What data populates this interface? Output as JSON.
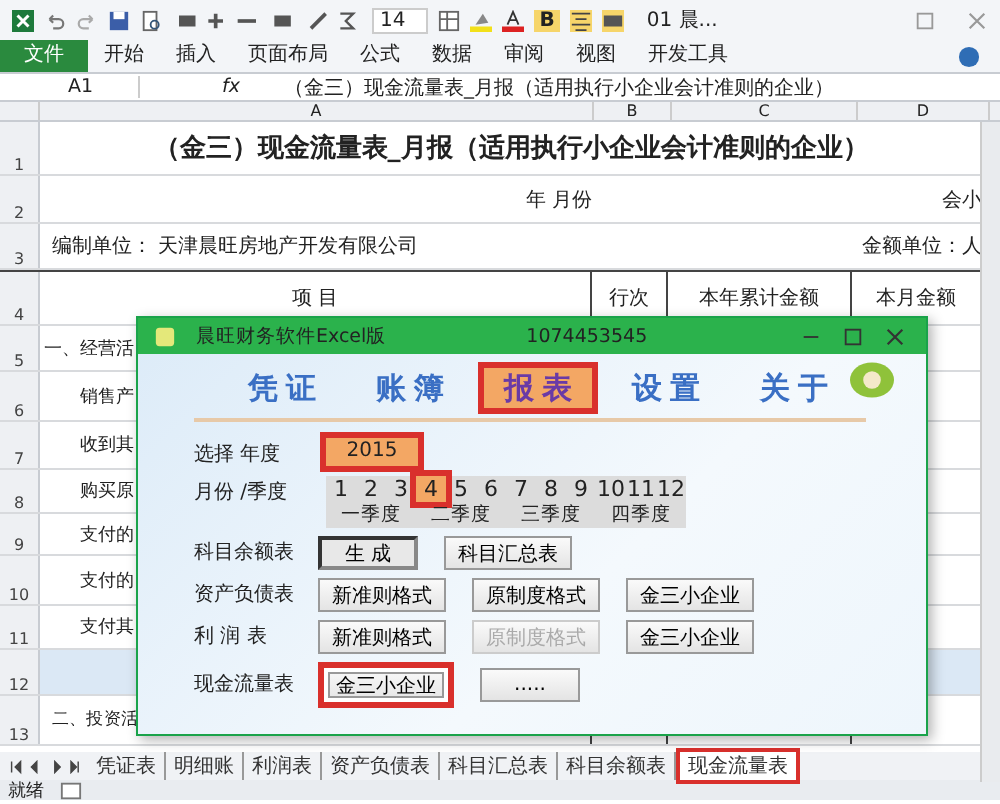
{
  "window": {
    "title": "01 晨..."
  },
  "toolbar": {
    "font_size": "14",
    "bold": "B"
  },
  "ribbon_tabs": [
    {
      "label": "文件",
      "selected": true
    },
    {
      "label": "开始",
      "selected": false
    },
    {
      "label": "插入",
      "selected": false
    },
    {
      "label": "页面布局",
      "selected": false
    },
    {
      "label": "公式",
      "selected": false
    },
    {
      "label": "数据",
      "selected": false
    },
    {
      "label": "审阅",
      "selected": false
    },
    {
      "label": "视图",
      "selected": false
    },
    {
      "label": "开发工具",
      "selected": false
    }
  ],
  "formula_bar": {
    "cell": "A1",
    "fx": "fx",
    "value": "（金三）现金流量表_月报（适用执行小企业会计准则的企业）"
  },
  "columns": [
    "A",
    "B",
    "C",
    "D"
  ],
  "rows": [
    {
      "num": "1",
      "kind": "title",
      "a": "（金三）现金流量表_月报（适用执行小企业会计准则的企业）"
    },
    {
      "num": "2",
      "kind": "info",
      "a": "年    月份",
      "d": "会小"
    },
    {
      "num": "3",
      "kind": "info",
      "a": "编制单位：   天津晨旺房地产开发有限公司",
      "d": "金额单位：人"
    },
    {
      "num": "4",
      "kind": "header",
      "a": "项    目",
      "b": "行次",
      "c": "本年累计金额",
      "d": "本月金额"
    },
    {
      "num": "5",
      "kind": "item",
      "a": "一、经营活"
    },
    {
      "num": "6",
      "kind": "item",
      "a": "销售产"
    },
    {
      "num": "7",
      "kind": "item",
      "a": "收到其"
    },
    {
      "num": "8",
      "kind": "item",
      "a": "购买原"
    },
    {
      "num": "9",
      "kind": "item",
      "a": "支付的"
    },
    {
      "num": "10",
      "kind": "item",
      "a": "支付的"
    },
    {
      "num": "11",
      "kind": "item",
      "a": "支付其"
    },
    {
      "num": "12",
      "kind": "band"
    },
    {
      "num": "13",
      "kind": "item",
      "a": "二、投资活"
    }
  ],
  "sheet_tabs": [
    {
      "label": "凭证表",
      "selected": false,
      "highlighted": false
    },
    {
      "label": "明细账",
      "selected": false,
      "highlighted": false
    },
    {
      "label": "利润表",
      "selected": false,
      "highlighted": false
    },
    {
      "label": "资产负债表",
      "selected": false,
      "highlighted": false
    },
    {
      "label": "科目汇总表",
      "selected": false,
      "highlighted": false
    },
    {
      "label": "科目余额表",
      "selected": false,
      "highlighted": false
    },
    {
      "label": "现金流量表",
      "selected": true,
      "highlighted": true
    }
  ],
  "status": "就绪",
  "dialog": {
    "title": "晨旺财务软件Excel版",
    "serial": "1074453545",
    "nav": [
      {
        "label": "凭证",
        "selected": false,
        "highlighted": false
      },
      {
        "label": "账簿",
        "selected": false,
        "highlighted": false
      },
      {
        "label": "报表",
        "selected": true,
        "highlighted": true
      },
      {
        "label": "设置",
        "selected": false,
        "highlighted": false
      },
      {
        "label": "关于",
        "selected": false,
        "highlighted": false
      }
    ],
    "year_label": "选择  年度",
    "year": "2015",
    "year_highlighted": true,
    "month_label": "月份 /季度",
    "months": [
      {
        "label": "1",
        "selected": false
      },
      {
        "label": "2",
        "selected": false
      },
      {
        "label": "3",
        "selected": false
      },
      {
        "label": "4",
        "selected": true
      },
      {
        "label": "5",
        "selected": false
      },
      {
        "label": "6",
        "selected": false
      },
      {
        "label": "7",
        "selected": false
      },
      {
        "label": "8",
        "selected": false
      },
      {
        "label": "9",
        "selected": false
      },
      {
        "label": "10",
        "selected": false
      },
      {
        "label": "11",
        "selected": false
      },
      {
        "label": "12",
        "selected": false
      }
    ],
    "quarters": [
      "一季度",
      "二季度",
      "三季度",
      "四季度"
    ],
    "reports": [
      {
        "label": "科目余额表",
        "buttons": [
          {
            "label": "生  成",
            "pressed": true,
            "disabled": false,
            "highlighted": false
          },
          {
            "label": "科目汇总表",
            "pressed": false,
            "disabled": false,
            "highlighted": false
          }
        ]
      },
      {
        "label": "资产负债表",
        "buttons": [
          {
            "label": "新准则格式",
            "pressed": false,
            "disabled": false,
            "highlighted": false
          },
          {
            "label": "原制度格式",
            "pressed": false,
            "disabled": false,
            "highlighted": false
          },
          {
            "label": "金三小企业",
            "pressed": false,
            "disabled": false,
            "highlighted": false
          }
        ]
      },
      {
        "label": "利  润  表",
        "buttons": [
          {
            "label": "新准则格式",
            "pressed": false,
            "disabled": false,
            "highlighted": false
          },
          {
            "label": "原制度格式",
            "pressed": false,
            "disabled": true,
            "highlighted": false
          },
          {
            "label": "金三小企业",
            "pressed": false,
            "disabled": false,
            "highlighted": false
          }
        ]
      },
      {
        "label": "现金流量表",
        "buttons": [
          {
            "label": "金三小企业",
            "pressed": false,
            "disabled": false,
            "highlighted": true
          },
          {
            "label": ".....",
            "pressed": false,
            "disabled": false,
            "highlighted": false
          }
        ]
      }
    ]
  }
}
